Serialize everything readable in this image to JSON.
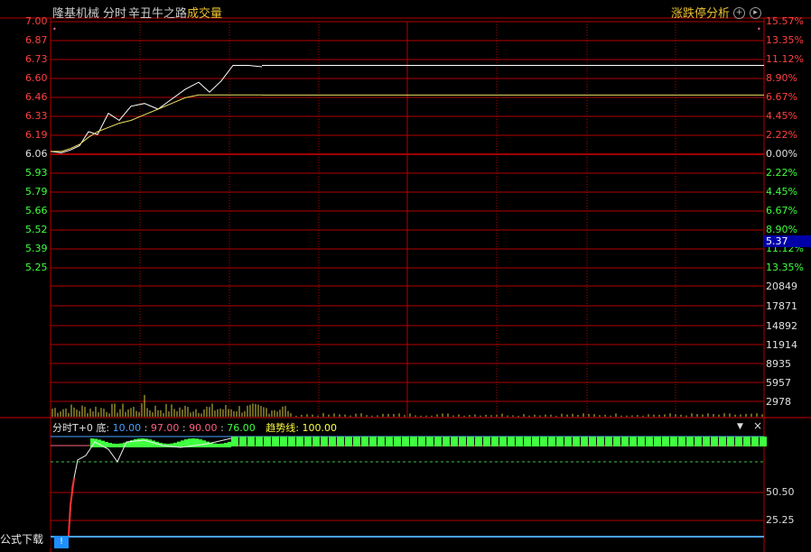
{
  "header": {
    "stock_name": "隆基机械",
    "view_mode": "分时",
    "indicator_name": "辛丑牛之路",
    "volume_label": "成交量",
    "analysis_button": "涨跌停分析"
  },
  "price_axis": {
    "left_labels": [
      "7.00",
      "6.87",
      "6.73",
      "6.60",
      "6.46",
      "6.33",
      "6.19",
      "6.06",
      "5.93",
      "5.79",
      "5.66",
      "5.52",
      "5.39",
      "5.25"
    ],
    "right_labels": [
      "15.57%",
      "13.35%",
      "11.12%",
      "8.90%",
      "6.67%",
      "4.45%",
      "2.22%",
      "0.00%",
      "2.22%",
      "4.45%",
      "6.67%",
      "8.90%",
      "11.12%",
      "13.35%"
    ],
    "prev_close": 6.06,
    "cursor_price": "5.37"
  },
  "volume_axis": {
    "labels": [
      "20849",
      "17871",
      "14892",
      "11914",
      "8935",
      "5957",
      "2978"
    ]
  },
  "indicator": {
    "name": "分时T+0",
    "bottom_label": "底:",
    "values": [
      "10.00",
      "97.00",
      "90.00",
      "76.00"
    ],
    "trend_label": "趋势线:",
    "trend_value": "100.00",
    "axis_labels": [
      "50.50",
      "25.25"
    ]
  },
  "footer": {
    "formula_download": "公式下载"
  },
  "colors": {
    "grid_red": "#b40000",
    "price_line": "#ffffff",
    "avg_line": "#f0e060",
    "up_text": "#ff4040",
    "down_text": "#40ff40",
    "volume_bar": "#d8c840",
    "indicator_green": "#40ff40",
    "blue_line": "#4aa0ff"
  },
  "chart_data": {
    "type": "line",
    "title": "隆基机械 分时",
    "series": [
      {
        "name": "price",
        "values": [
          6.08,
          6.07,
          6.09,
          6.12,
          6.22,
          6.2,
          6.35,
          6.3,
          6.4,
          6.42,
          6.38,
          6.45,
          6.52,
          6.57,
          6.5,
          6.58,
          6.69,
          6.69,
          6.68
        ]
      },
      {
        "name": "avg",
        "values": [
          6.08,
          6.08,
          6.1,
          6.13,
          6.18,
          6.22,
          6.25,
          6.28,
          6.3,
          6.34,
          6.38,
          6.42,
          6.46,
          6.48,
          6.48,
          6.48,
          6.48,
          6.48,
          6.48
        ]
      }
    ],
    "ylim": [
      5.12,
      7.0
    ]
  }
}
